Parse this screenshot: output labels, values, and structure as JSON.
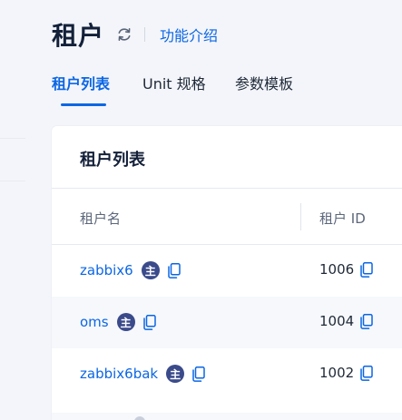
{
  "header": {
    "title": "租户",
    "intro_link": "功能介绍"
  },
  "tabs": [
    {
      "label": "租户列表",
      "active": true
    },
    {
      "label": "Unit 规格",
      "active": false
    },
    {
      "label": "参数模板",
      "active": false
    }
  ],
  "card": {
    "title": "租户列表",
    "columns": [
      "租户名",
      "租户 ID"
    ],
    "badge_label": "主",
    "rows": [
      {
        "name": "zabbix6",
        "id": "1006"
      },
      {
        "name": "oms",
        "id": "1004"
      },
      {
        "name": "zabbix6bak",
        "id": "1002"
      }
    ]
  },
  "colors": {
    "accent": "#0b66e4",
    "badge": "#3a4a8a",
    "background": "#f3f5fa"
  },
  "icons": {
    "refresh": "refresh-icon",
    "copy": "copy-icon"
  }
}
